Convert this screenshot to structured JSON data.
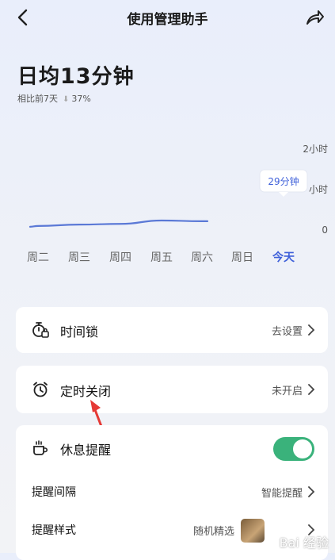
{
  "header": {
    "title": "使用管理助手"
  },
  "summary": {
    "prefix": "日均",
    "number": "13",
    "unit": "分钟",
    "compare_label": "相比前7天",
    "compare_value": "37%"
  },
  "tooltip": {
    "value": "29分钟"
  },
  "chart_data": {
    "type": "line",
    "categories": [
      "周二",
      "周三",
      "周四",
      "周五",
      "周六",
      "周日",
      "今天"
    ],
    "y_ticks": [
      "2小时",
      "小时",
      "0"
    ],
    "x_ticks_before_today": [
      "周二",
      "周三",
      "周四",
      "周五",
      "周六",
      "周日"
    ],
    "today_label": "今天",
    "values": [
      6,
      8,
      9,
      14,
      13,
      null,
      29
    ],
    "ylim": [
      0,
      120
    ],
    "grid": false,
    "colors": {
      "line": "#5b79d6",
      "today": "#3d5fd9"
    }
  },
  "settings": {
    "time_lock": {
      "label": "时间锁",
      "value": "去设置"
    },
    "scheduled_off": {
      "label": "定时关闭",
      "value": "未开启"
    },
    "rest_reminder": {
      "label": "休息提醒",
      "enabled": true
    },
    "reminder_interval": {
      "label": "提醒间隔",
      "value": "智能提醒"
    },
    "reminder_style": {
      "label": "提醒样式",
      "value": "随机精选"
    }
  },
  "watermark": {
    "text": "Bai 经验"
  },
  "colors": {
    "accent": "#3ab27b",
    "annotation_arrow": "#e53935"
  }
}
